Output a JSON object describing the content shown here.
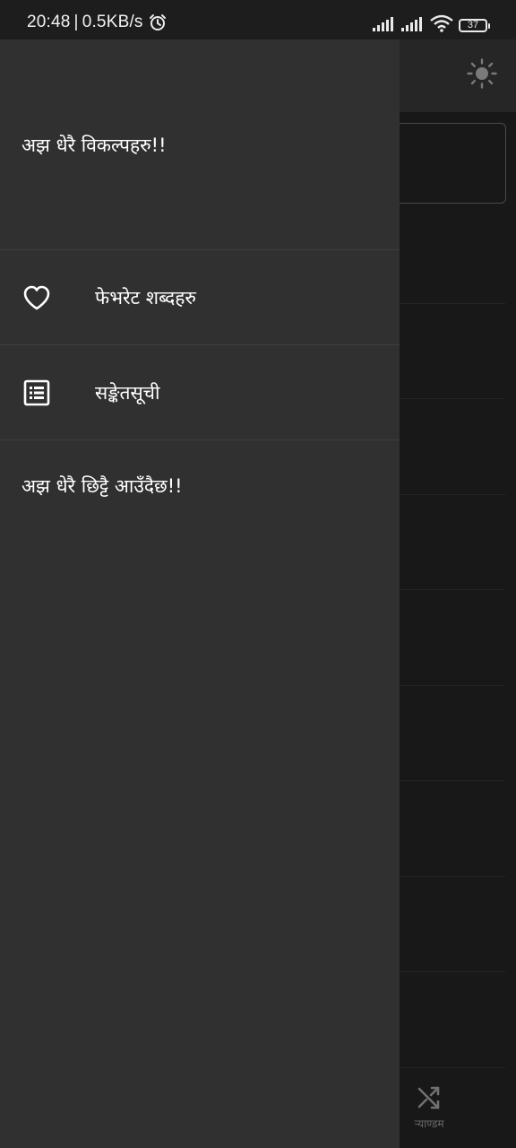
{
  "status_bar": {
    "time": "20:48",
    "network_speed": "0.5KB/s",
    "separator": "|",
    "battery_level": "37",
    "icons": [
      "alarm-icon",
      "signal-icon",
      "signal-icon",
      "wifi-icon",
      "battery-icon"
    ]
  },
  "app": {
    "toolbar_icon": "sun-icon",
    "random_tab_label": "र्‍याण्डम",
    "random_tab_icon": "shuffle-icon"
  },
  "drawer": {
    "header_text": "अझ धेरै विकल्पहरु!!",
    "items": [
      {
        "label": "फेभरेट शब्दहरु",
        "icon": "heart-outline-icon"
      },
      {
        "label": "सङ्केतसूची",
        "icon": "list-icon"
      }
    ],
    "footer_text": "अझ धेरै छिट्टै आउँदैछ!!"
  },
  "colors": {
    "drawer_bg": "#303030",
    "app_bg": "#181818",
    "toolbar_bg": "#262626",
    "text": "#ffffff",
    "divider": "#3e3e3e"
  }
}
